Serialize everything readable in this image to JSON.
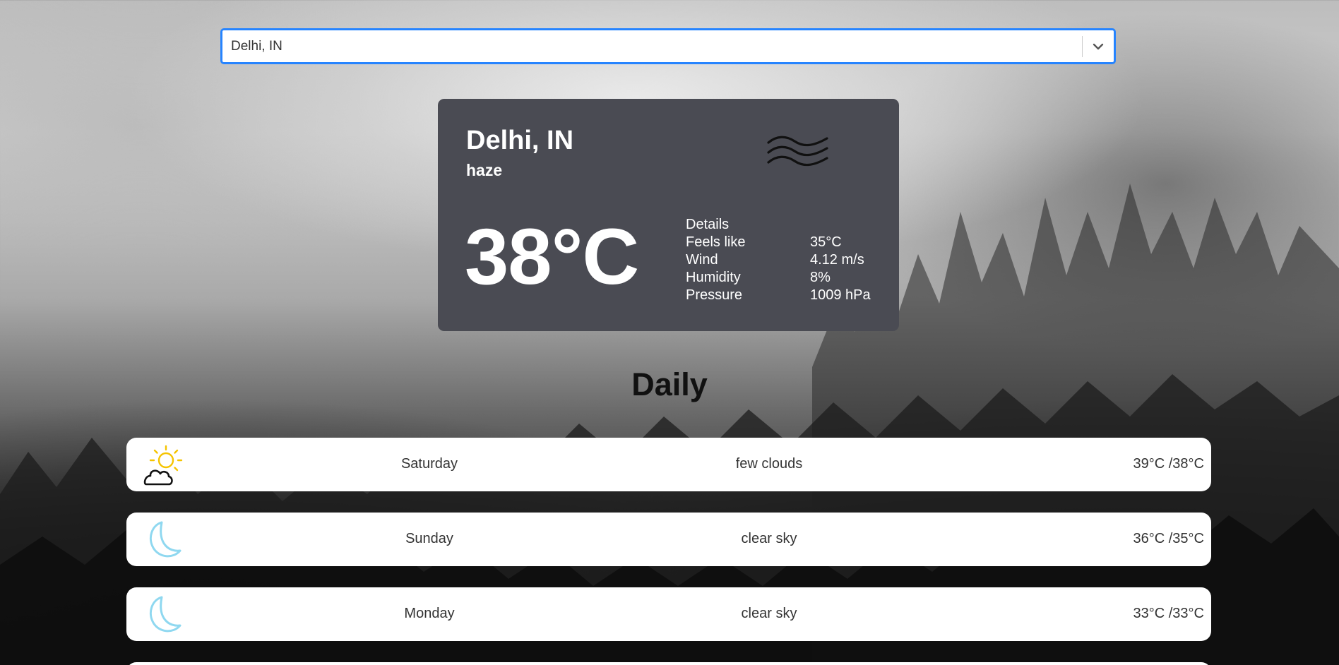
{
  "search": {
    "value": "Delhi, IN"
  },
  "current": {
    "city": "Delhi, IN",
    "description": "haze",
    "temperature": "38°C",
    "icon": "haze-icon",
    "details_title": "Details",
    "details": [
      {
        "label": "Feels like",
        "value": "35°C"
      },
      {
        "label": "Wind",
        "value": "4.12 m/s"
      },
      {
        "label": "Humidity",
        "value": "8%"
      },
      {
        "label": "Pressure",
        "value": "1009 hPa"
      }
    ]
  },
  "daily": {
    "heading": "Daily",
    "items": [
      {
        "day": "Saturday",
        "description": "few clouds",
        "temps": "39°C /38°C",
        "icon": "sun-cloud-icon"
      },
      {
        "day": "Sunday",
        "description": "clear sky",
        "temps": "36°C /35°C",
        "icon": "moon-icon"
      },
      {
        "day": "Monday",
        "description": "clear sky",
        "temps": "33°C /33°C",
        "icon": "moon-icon"
      }
    ]
  },
  "colors": {
    "card_bg": "#4a4b53",
    "focus_border": "#2684ff",
    "sun": "#f5c400",
    "moon": "#8fd8f0"
  }
}
